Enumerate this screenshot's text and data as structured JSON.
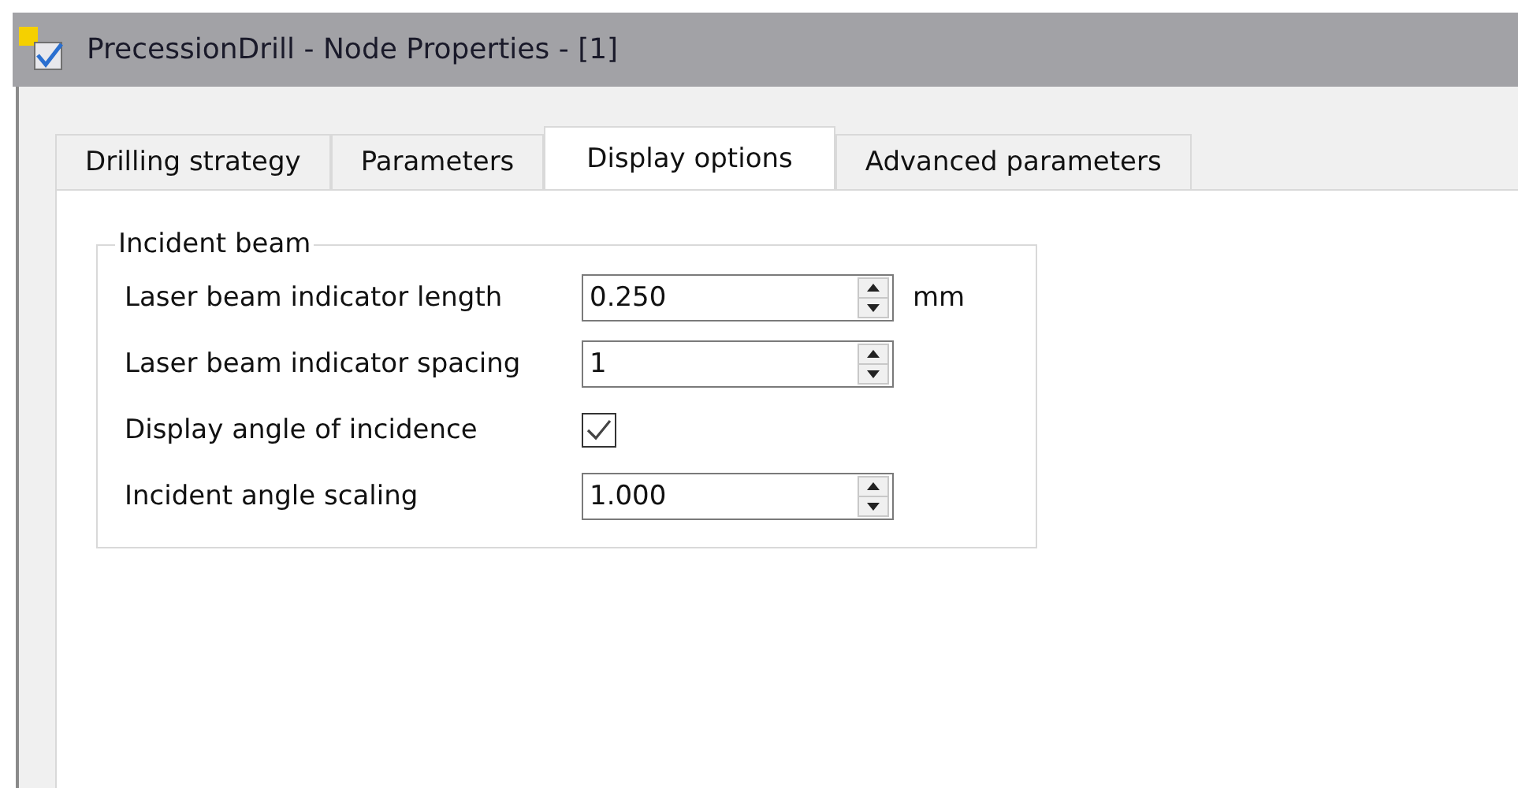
{
  "window": {
    "title": "PrecessionDrill - Node Properties - [1]"
  },
  "tabs": [
    {
      "label": "Drilling strategy",
      "selected": false
    },
    {
      "label": "Parameters",
      "selected": false
    },
    {
      "label": "Display options",
      "selected": true
    },
    {
      "label": "Advanced parameters",
      "selected": false
    }
  ],
  "group": {
    "title": "Incident beam",
    "rows": [
      {
        "kind": "spin",
        "label": "Laser beam indicator length",
        "value": "0.250",
        "unit": "mm"
      },
      {
        "kind": "spin",
        "label": "Laser beam indicator spacing",
        "value": "1"
      },
      {
        "kind": "check",
        "label": "Display angle of incidence",
        "checked": true
      },
      {
        "kind": "spin",
        "label": "Incident angle scaling",
        "value": "1.000"
      }
    ]
  }
}
